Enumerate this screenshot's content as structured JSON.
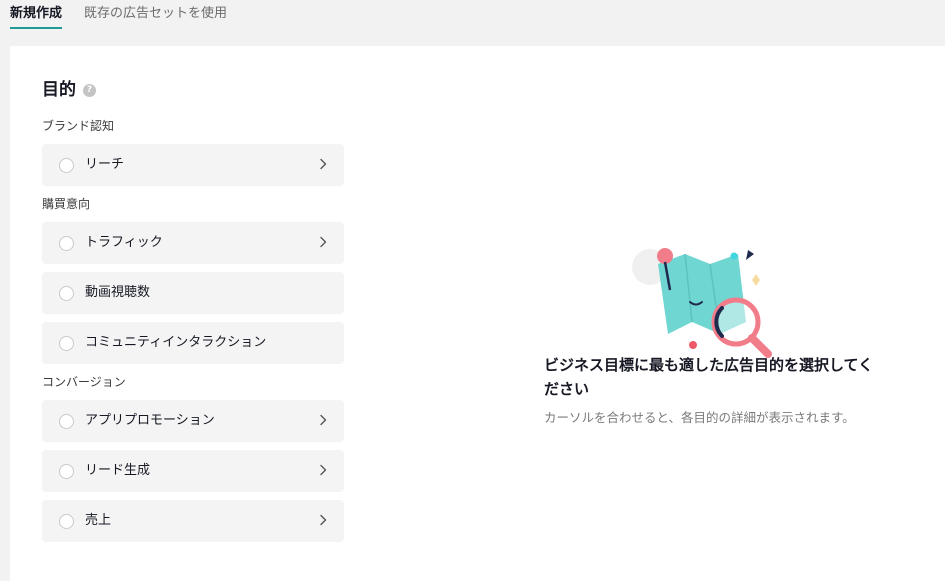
{
  "tabs": {
    "new": "新規作成",
    "existing": "既存の広告セットを使用"
  },
  "objective": {
    "title": "目的",
    "help_icon": "?",
    "sections": {
      "awareness": "ブランド認知",
      "consideration": "購買意向",
      "conversion": "コンバージョン"
    },
    "options": {
      "reach": "リーチ",
      "traffic": "トラフィック",
      "video_views": "動画視聴数",
      "community": "コミュニティインタラクション",
      "app_promotion": "アプリプロモーション",
      "lead_gen": "リード生成",
      "sales": "売上"
    }
  },
  "empty_state": {
    "title": "ビジネス目標に最も適した広告目的を選択してください",
    "description": "カーソルを合わせると、各目的の詳細が表示されます。",
    "illustration": "map-magnifier-illustration"
  },
  "colors": {
    "accent": "#1e9a97",
    "map": "#6fd6d2",
    "pin": "#f27d8a",
    "navy": "#1f2a4d"
  }
}
